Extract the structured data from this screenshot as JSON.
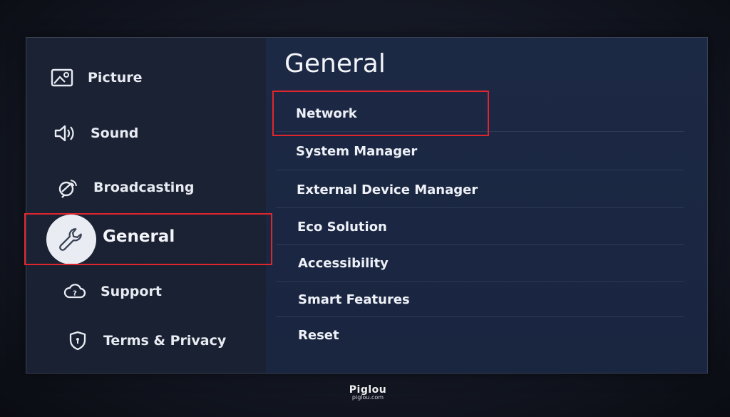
{
  "sidebar": {
    "items": [
      {
        "label": "Picture",
        "icon": "picture-icon"
      },
      {
        "label": "Sound",
        "icon": "speaker-icon"
      },
      {
        "label": "Broadcasting",
        "icon": "satellite-icon"
      },
      {
        "label": "General",
        "icon": "wrench-icon",
        "selected": true
      },
      {
        "label": "Support",
        "icon": "cloud-help-icon"
      },
      {
        "label": "Terms & Privacy",
        "icon": "shield-icon"
      }
    ]
  },
  "main": {
    "title": "General",
    "items": [
      {
        "label": "Network",
        "highlighted": true
      },
      {
        "label": "System Manager"
      },
      {
        "label": "External Device Manager"
      },
      {
        "label": "Eco Solution"
      },
      {
        "label": "Accessibility"
      },
      {
        "label": "Smart Features"
      },
      {
        "label": "Reset"
      }
    ]
  },
  "watermark": {
    "brand": "Piglou",
    "site": "piglou.com"
  },
  "colors": {
    "highlight": "#e0262c",
    "content_bg": "#1c2944",
    "sidebar_bg": "#1b2234"
  }
}
